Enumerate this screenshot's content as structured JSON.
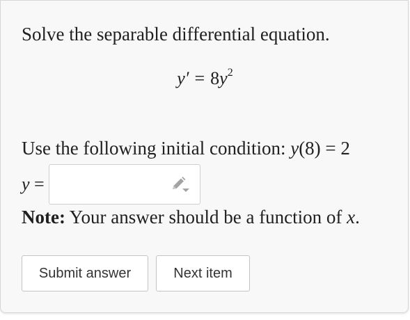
{
  "question": {
    "prompt": "Solve the separable differential equation.",
    "equation": {
      "lhs": "y′",
      "op": "=",
      "coef": "8",
      "var": "y",
      "exponent": "2"
    },
    "condition": {
      "text": "Use the following initial condition: ",
      "func": "y",
      "arg": "(8)",
      "op": " = ",
      "value": "2"
    },
    "answer": {
      "var": "y",
      "eq": " =",
      "value": "",
      "placeholder": ""
    },
    "note": {
      "label": "Note:",
      "text": " Your answer should be a function of ",
      "var": "x",
      "end": "."
    }
  },
  "actions": {
    "submit_label": "Submit answer",
    "next_label": "Next item"
  },
  "icons": {
    "edit": "pencil-dropdown-icon"
  },
  "colors": {
    "text": "#202020",
    "card_bg": "#f8f8f8",
    "icon": "#9a9a9a"
  }
}
